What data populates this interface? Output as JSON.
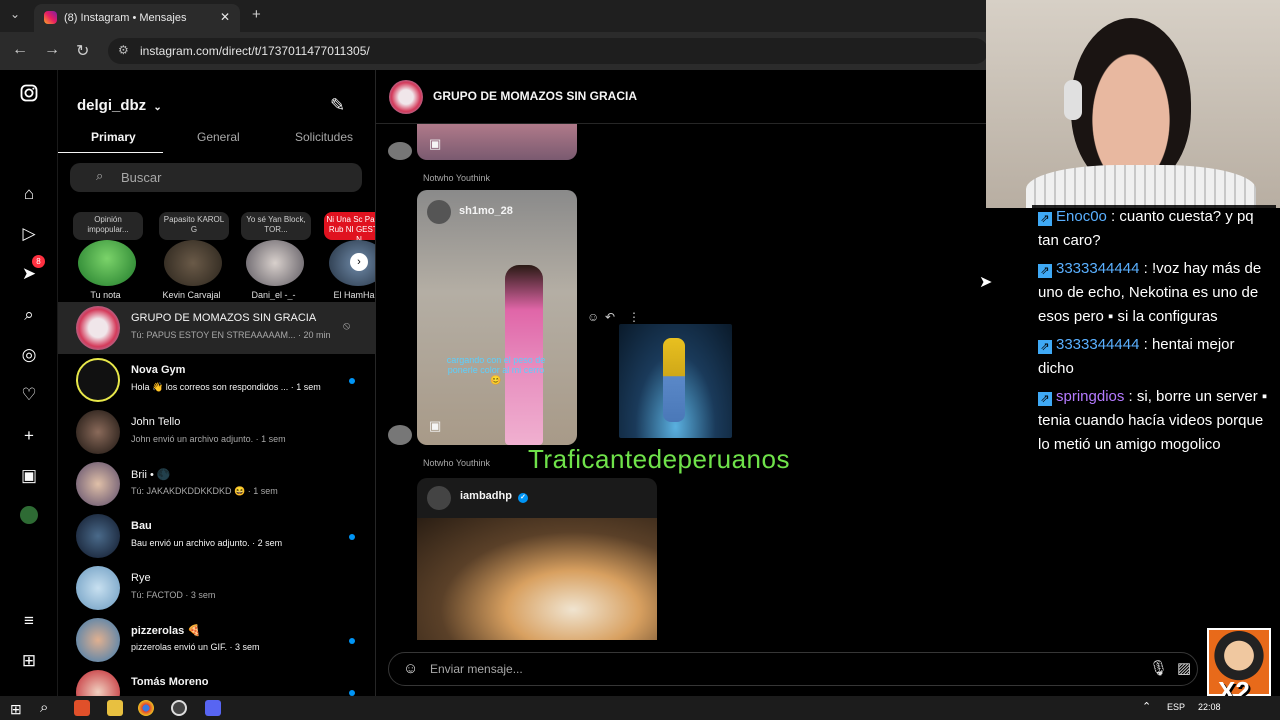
{
  "browser": {
    "tab_title": "(8) Instagram • Mensajes",
    "url": "instagram.com/direct/t/1737011477011305/"
  },
  "rail": {
    "badge": "8"
  },
  "inbox": {
    "username": "delgi_dbz",
    "tabs": [
      "Primary",
      "General",
      "Solicitudes"
    ],
    "search_placeholder": "Buscar",
    "notes": [
      {
        "bubble": "Opinión impopular...",
        "name": "Tu nota"
      },
      {
        "bubble": "Papasito KAROL G",
        "name": "Kevin Carvajal"
      },
      {
        "bubble": "Yo sé Yan Block, TOR...",
        "name": "Dani_el -_-"
      },
      {
        "bubble": "Ni Una Sc Paulina Rub NI GESTOS N",
        "name": "El HamHan"
      }
    ],
    "conversations": [
      {
        "name": "GRUPO DE MOMAZOS SIN GRACIA",
        "preview": "Tú: PAPUS ESTOY EN STREAAAAAM... · 20 min"
      },
      {
        "name": "Nova Gym",
        "preview": "Hola 👋 los correos son respondidos ... · 1 sem"
      },
      {
        "name": "John Tello",
        "preview": "John envió un archivo adjunto. · 1 sem"
      },
      {
        "name": "Brii • 🌑",
        "preview": "Tú: JAKAKDKDDKKDKD 😆 · 1 sem"
      },
      {
        "name": "Bau",
        "preview": "Bau envió un archivo adjunto. · 2 sem"
      },
      {
        "name": "Rye",
        "preview": "Tú: FACTOD · 3 sem"
      },
      {
        "name": "pizzerolas 🍕",
        "preview": "pizzerolas envió un GIF. · 3 sem"
      },
      {
        "name": "Tomás Moreno",
        "preview": ""
      }
    ]
  },
  "chat": {
    "title": "GRUPO DE MOMAZOS SIN GRACIA",
    "sender1": "Notwho Youthink",
    "post_user": "sh1mo_28",
    "caption": "cargando con el peso de ponerle color al mi cerro 😊",
    "sender2": "Notwho Youthink",
    "post2_user": "iambadhp",
    "overlay": "Traficantedeperuanos",
    "composer_placeholder": "Enviar mensaje..."
  },
  "twitch_chat": [
    {
      "user": "Enoc0o",
      "text": ": cuanto cuesta? y pq tan caro?",
      "color": "#5ab0ff"
    },
    {
      "user": "3333344444",
      "text": ": !voz hay más de uno de echo, Nekotina es uno de esos pero ▪ si la configuras",
      "color": "#5ab0ff"
    },
    {
      "user": "3333344444",
      "text": ": hentai mejor dicho",
      "color": "#5ab0ff"
    },
    {
      "user": "springdios",
      "text": ": si, borre un server ▪ tenia cuando hacía videos porque lo metió un amigo mogolico",
      "color": "#b57bff"
    }
  ],
  "taskbar": {
    "lang": "ESP",
    "time": "22:08"
  },
  "stream_overlay": {
    "badge": "X2"
  }
}
